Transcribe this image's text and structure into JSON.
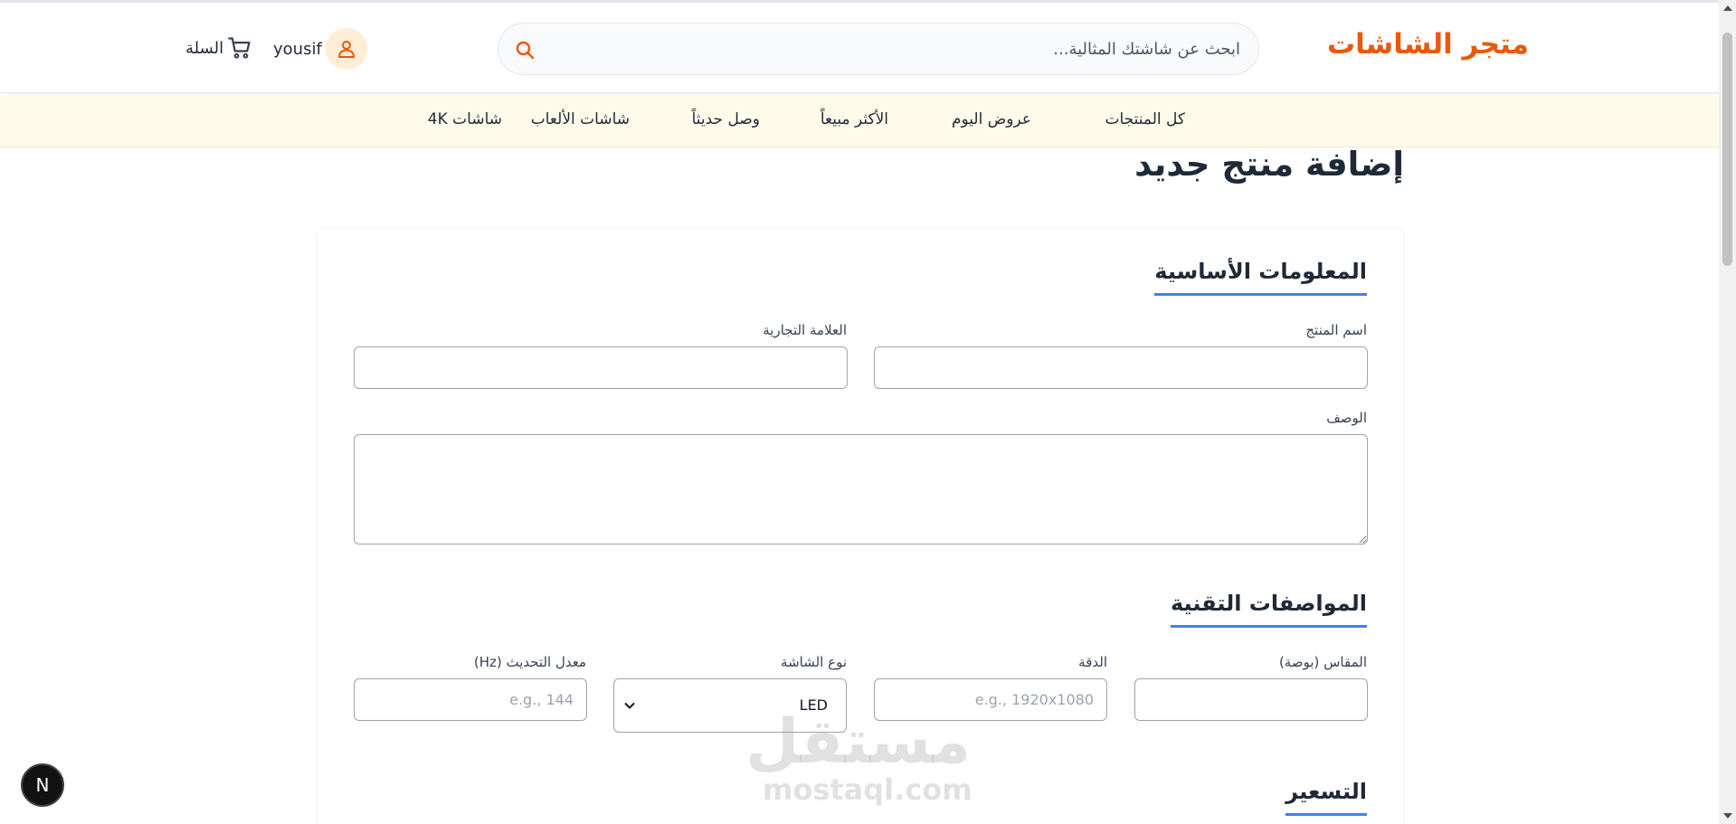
{
  "header": {
    "logo": "متجر الشاشات",
    "search_placeholder": "ابحث عن شاشتك المثالية...",
    "user_name": "yousif",
    "cart_label": "السلة"
  },
  "nav": {
    "items": [
      "كل المنتجات",
      "عروض اليوم",
      "الأكثر مبيعاً",
      "وصل حديثاً",
      "شاشات الألعاب",
      "شاشات 4K"
    ]
  },
  "page": {
    "title": "إضافة منتج جديد"
  },
  "form": {
    "basic_info": {
      "title": "المعلومات الأساسية",
      "product_name_label": "اسم المنتج",
      "brand_label": "العلامة التجارية",
      "description_label": "الوصف"
    },
    "tech_specs": {
      "title": "المواصفات التقنية",
      "size_label": "المقاس (بوصة)",
      "resolution_label": "الدقة",
      "resolution_placeholder": "e.g., 1920x1080",
      "screen_type_label": "نوع الشاشة",
      "screen_type_value": "LED",
      "refresh_rate_label": "معدل التحديث (Hz)",
      "refresh_rate_placeholder": "e.g., 144"
    },
    "pricing": {
      "title": "التسعير"
    }
  },
  "watermark": {
    "arabic": "مستقل",
    "latin": "mostaql.com"
  },
  "badge": {
    "letter": "N"
  },
  "colors": {
    "brand": "#ea580c",
    "accent": "#3b82f6",
    "nav_bg": "#fffbeb"
  }
}
